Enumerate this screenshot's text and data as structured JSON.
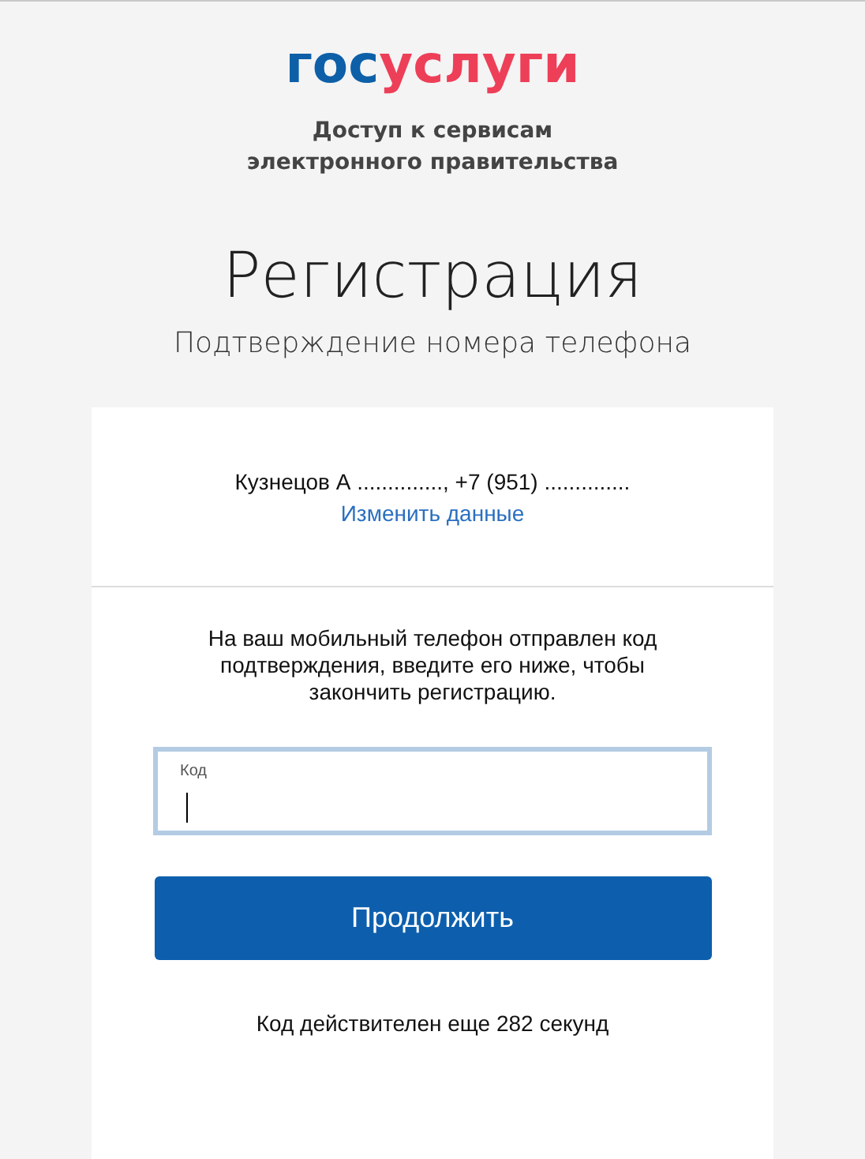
{
  "logo": {
    "primary": "гос",
    "accent": "услуги"
  },
  "tagline": [
    "Доступ к сервисам",
    "электронного правительства"
  ],
  "title": "Регистрация",
  "subtitle": "Подтверждение номера телефона",
  "user_info": "Кузнецов А .............., +7 (951) ..............",
  "change_link": "Изменить данные",
  "message": "На ваш мобильный телефон отправлен код подтверждения, введите его ниже, чтобы закончить регистрацию.",
  "code_field": {
    "label": "Код",
    "focused": true
  },
  "continue_button": "Продолжить",
  "timer": "Код действителен еще 282 секунд"
}
